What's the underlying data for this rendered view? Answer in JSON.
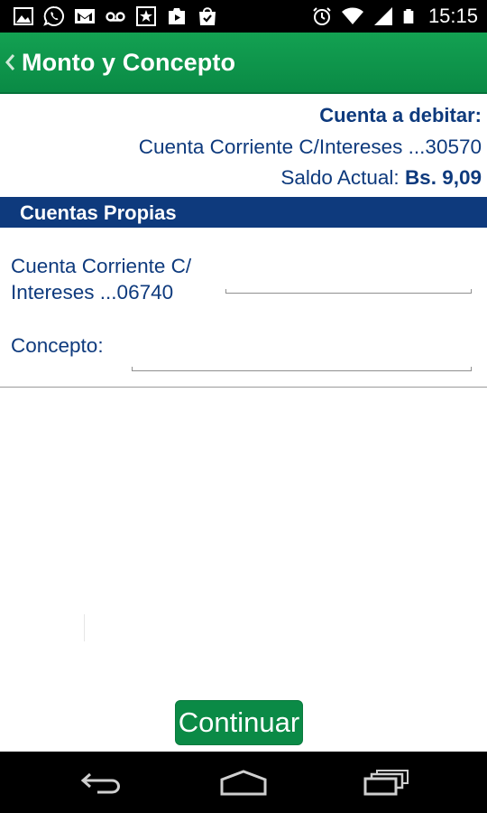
{
  "status_bar": {
    "time": "15:15",
    "icons_left": [
      "gallery-icon",
      "whatsapp-icon",
      "gmail-icon",
      "voicemail-icon",
      "store-icon",
      "play-store-icon",
      "shopping-bag-icon"
    ],
    "icons_right": [
      "alarm-icon",
      "wifi-icon",
      "signal-icon",
      "battery-icon"
    ]
  },
  "action_bar": {
    "title": "Monto y Concepto",
    "background": "#0a8a45"
  },
  "account": {
    "label": "Cuenta a debitar:",
    "name": "Cuenta Corriente C/Intereses ...30570",
    "balance_label": "Saldo Actual:",
    "balance_amount": "Bs. 9,09"
  },
  "section": {
    "title": "Cuentas Propias",
    "background": "#0e3a7d"
  },
  "form": {
    "destination_label": "Cuenta Corriente C/ Intereses ...06740",
    "amount_value": "",
    "concept_label": "Concepto:",
    "concept_value": ""
  },
  "continue_button": {
    "label": "Continuar"
  },
  "nav_bar": {
    "buttons": [
      "back-icon",
      "home-icon",
      "recent-apps-icon"
    ]
  },
  "colors": {
    "text_primary": "#0e3a7d",
    "accent_green": "#0b8a46"
  }
}
